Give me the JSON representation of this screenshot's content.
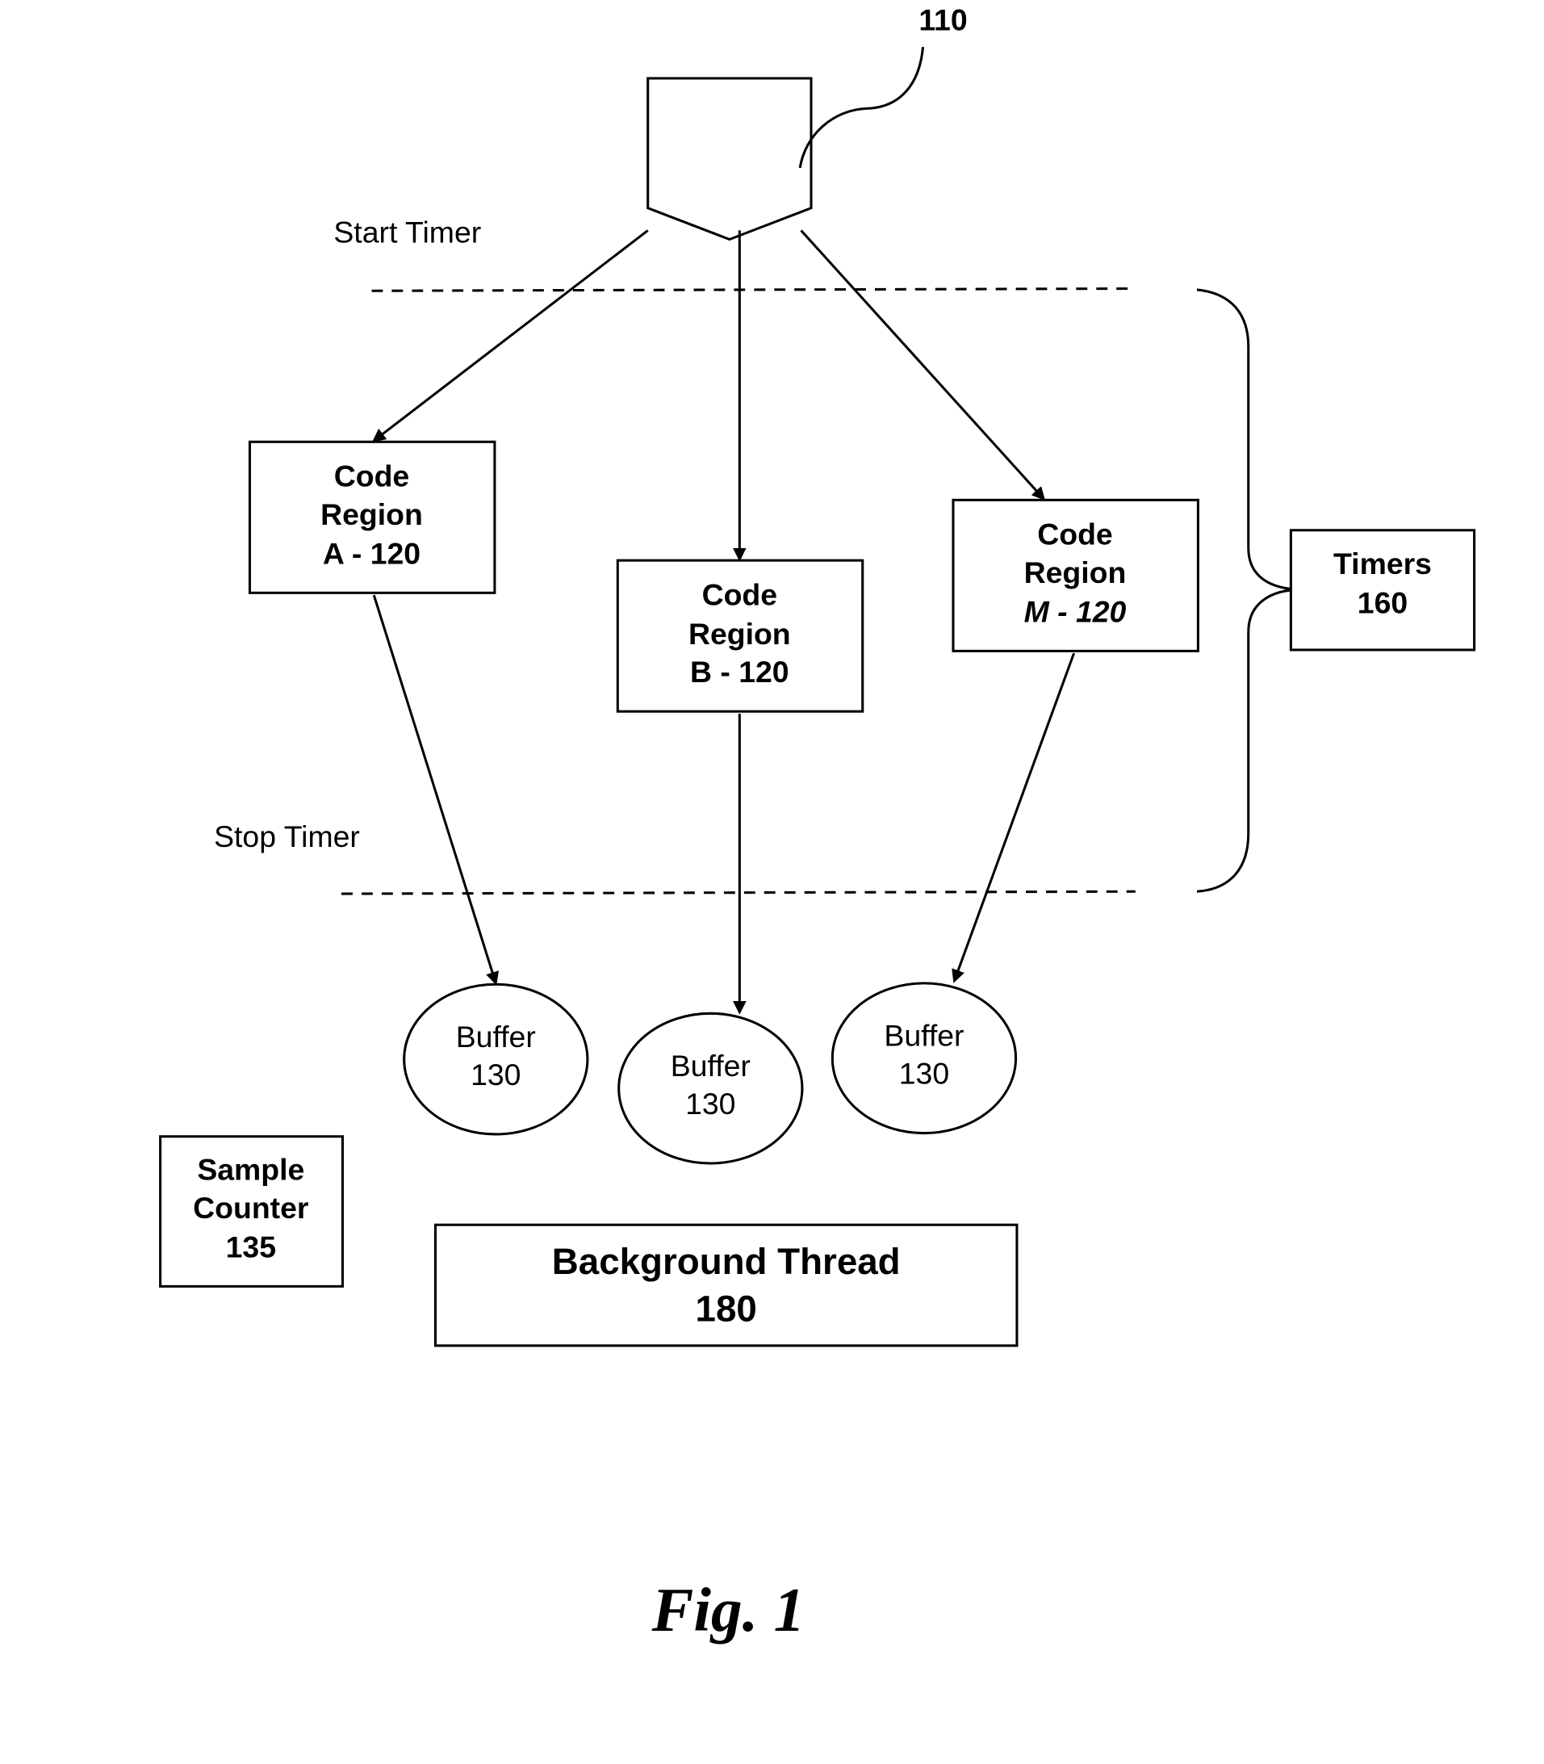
{
  "figure": {
    "caption": "Fig. 1",
    "entry_ref": "110",
    "start_label": "Start Timer",
    "stop_label": "Stop Timer",
    "code_regions": [
      {
        "line1": "Code",
        "line2": "Region",
        "line3": "A - 120",
        "italic_line3": false
      },
      {
        "line1": "Code",
        "line2": "Region",
        "line3": "B - 120",
        "italic_line3": false
      },
      {
        "line1": "Code",
        "line2": "Region",
        "line3": "M - 120",
        "italic_line3": true
      }
    ],
    "buffers": [
      {
        "line1": "Buffer",
        "line2": "130"
      },
      {
        "line1": "Buffer",
        "line2": "130"
      },
      {
        "line1": "Buffer",
        "line2": "130"
      }
    ],
    "timers": {
      "line1": "Timers",
      "line2": "160"
    },
    "sample_counter": {
      "line1": "Sample",
      "line2": "Counter",
      "line3": "135"
    },
    "background_thread": {
      "line1": "Background Thread",
      "line2": "180"
    }
  }
}
